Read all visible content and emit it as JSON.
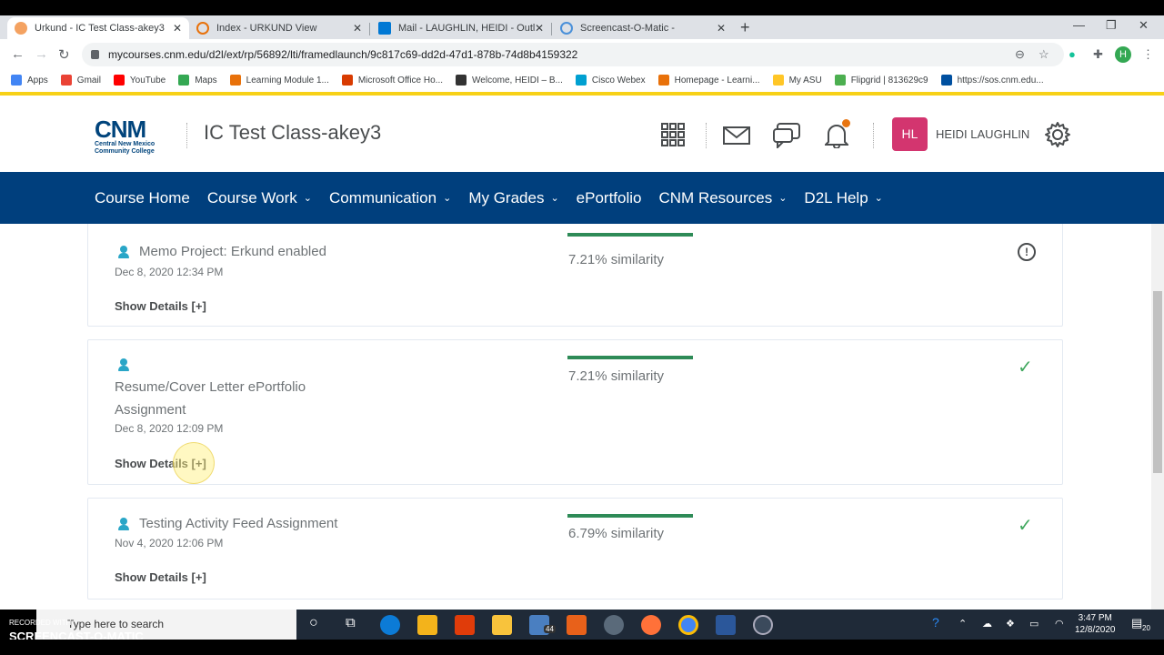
{
  "browser": {
    "tabs": [
      {
        "title": "Urkund - IC Test Class-akey3",
        "active": true,
        "favicon_color": "#f4a261"
      },
      {
        "title": "Index - URKUND View",
        "active": false,
        "favicon_color": "#e8710a"
      },
      {
        "title": "Mail - LAUGHLIN, HEIDI - Outlo",
        "active": false,
        "favicon_color": "#0078d4"
      },
      {
        "title": "Screencast-O-Matic -",
        "active": false,
        "favicon_color": "#4a90d9"
      }
    ],
    "new_tab": "+",
    "url": "mycourses.cnm.edu/d2l/ext/rp/56892/lti/framedlaunch/9c817c69-dd2d-47d1-878b-74d8b4159322",
    "profile_initial": "H",
    "bookmarks": [
      {
        "label": "Apps",
        "color": "#4285f4"
      },
      {
        "label": "Gmail",
        "color": "#ea4335"
      },
      {
        "label": "YouTube",
        "color": "#ff0000"
      },
      {
        "label": "Maps",
        "color": "#34a853"
      },
      {
        "label": "Learning Module 1...",
        "color": "#e8710a"
      },
      {
        "label": "Microsoft Office Ho...",
        "color": "#d83b01"
      },
      {
        "label": "Welcome, HEIDI – B...",
        "color": "#333333"
      },
      {
        "label": "Cisco Webex",
        "color": "#00a0d1"
      },
      {
        "label": "Homepage - Learni...",
        "color": "#e8710a"
      },
      {
        "label": "My ASU",
        "color": "#ffc627"
      },
      {
        "label": "Flipgrid | 813629c9",
        "color": "#4caf50"
      },
      {
        "label": "https://sos.cnm.edu...",
        "color": "#0050a0"
      }
    ]
  },
  "header": {
    "logo_text": "CNM",
    "logo_subtext": "Central New Mexico Community College",
    "course_title": "IC Test Class-akey3",
    "user_initials": "HL",
    "user_name": "HEIDI LAUGHLIN",
    "accent_color": "#d3356f"
  },
  "nav": {
    "items": [
      {
        "label": "Course Home",
        "dropdown": false
      },
      {
        "label": "Course Work",
        "dropdown": true
      },
      {
        "label": "Communication",
        "dropdown": true
      },
      {
        "label": "My Grades",
        "dropdown": true
      },
      {
        "label": "ePortfolio",
        "dropdown": false
      },
      {
        "label": "CNM Resources",
        "dropdown": true
      },
      {
        "label": "D2L Help",
        "dropdown": true
      }
    ],
    "bg_color": "#003f7d"
  },
  "submissions": [
    {
      "title": "Memo Project: Erkund enabled",
      "date": "Dec 8, 2020 12:34 PM",
      "similarity": "7.21% similarity",
      "details": "Show Details [+]",
      "status": "warning"
    },
    {
      "title": "Resume/Cover Letter ePortfolio Assignment",
      "date": "Dec 8, 2020 12:09 PM",
      "similarity": "7.21% similarity",
      "details": "Show Details [+]",
      "status": "ok"
    },
    {
      "title": "Testing Activity Feed Assignment",
      "date": "Nov 4, 2020 12:06 PM",
      "similarity": "6.79% similarity",
      "details": "Show Details [+]",
      "status": "ok"
    }
  ],
  "taskbar": {
    "search_placeholder": "Type here to search",
    "badge": "44",
    "notif_count": "20",
    "time": "3:47 PM",
    "date": "12/8/2020",
    "recorder_text": "RECORDED WITH",
    "recorder_brand": "SCREENCAST-O-MATIC"
  }
}
